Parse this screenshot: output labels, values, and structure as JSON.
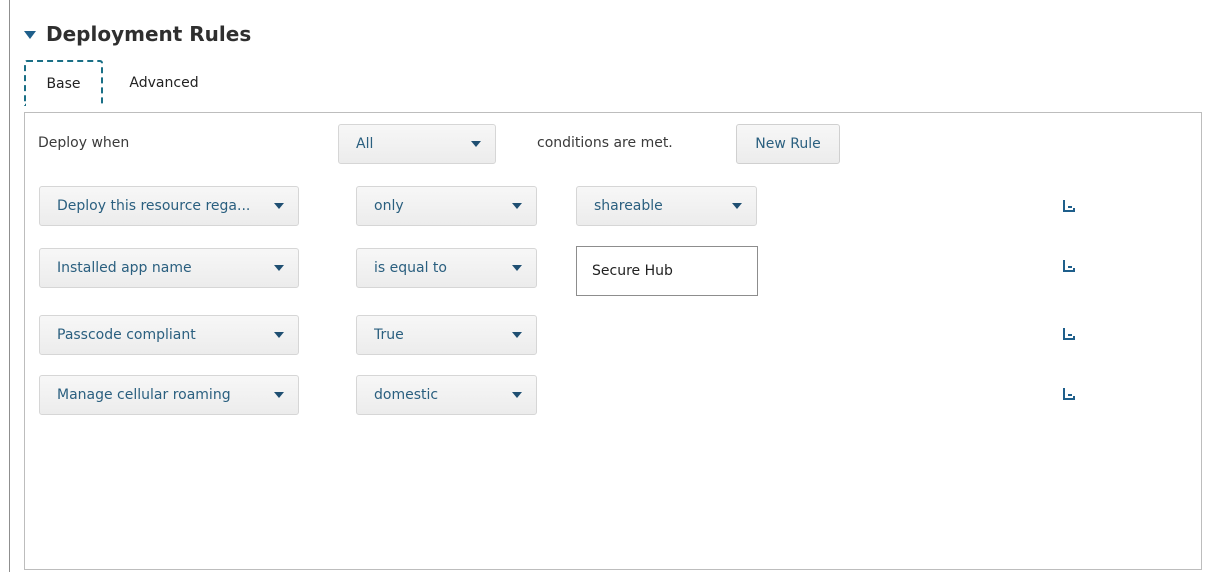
{
  "section": {
    "title": "Deployment Rules"
  },
  "tabs": [
    {
      "label": "Base",
      "active": true
    },
    {
      "label": "Advanced",
      "active": false
    }
  ],
  "header_row": {
    "deploy_when_label": "Deploy when",
    "condition_mode": "All",
    "conditions_text": "conditions are met.",
    "new_rule_label": "New Rule"
  },
  "rules": [
    {
      "field": "Deploy this resource rega...",
      "operator": "only",
      "value_type": "select",
      "value": "shareable"
    },
    {
      "field": "Installed app name",
      "operator": "is equal to",
      "value_type": "text",
      "value": "Secure Hub"
    },
    {
      "field": "Passcode compliant",
      "operator": "True",
      "value_type": "none",
      "value": ""
    },
    {
      "field": "Manage cellular roaming",
      "operator": "domestic",
      "value_type": "none",
      "value": ""
    }
  ],
  "icons": {
    "delete_rule": "delete-rule-icon",
    "section_toggle": "caret-down-icon",
    "dropdown": "chevron-down-icon"
  },
  "colors": {
    "accent": "#1a6f86",
    "link_text": "#2a5f7f",
    "caret": "#1f4f72"
  }
}
